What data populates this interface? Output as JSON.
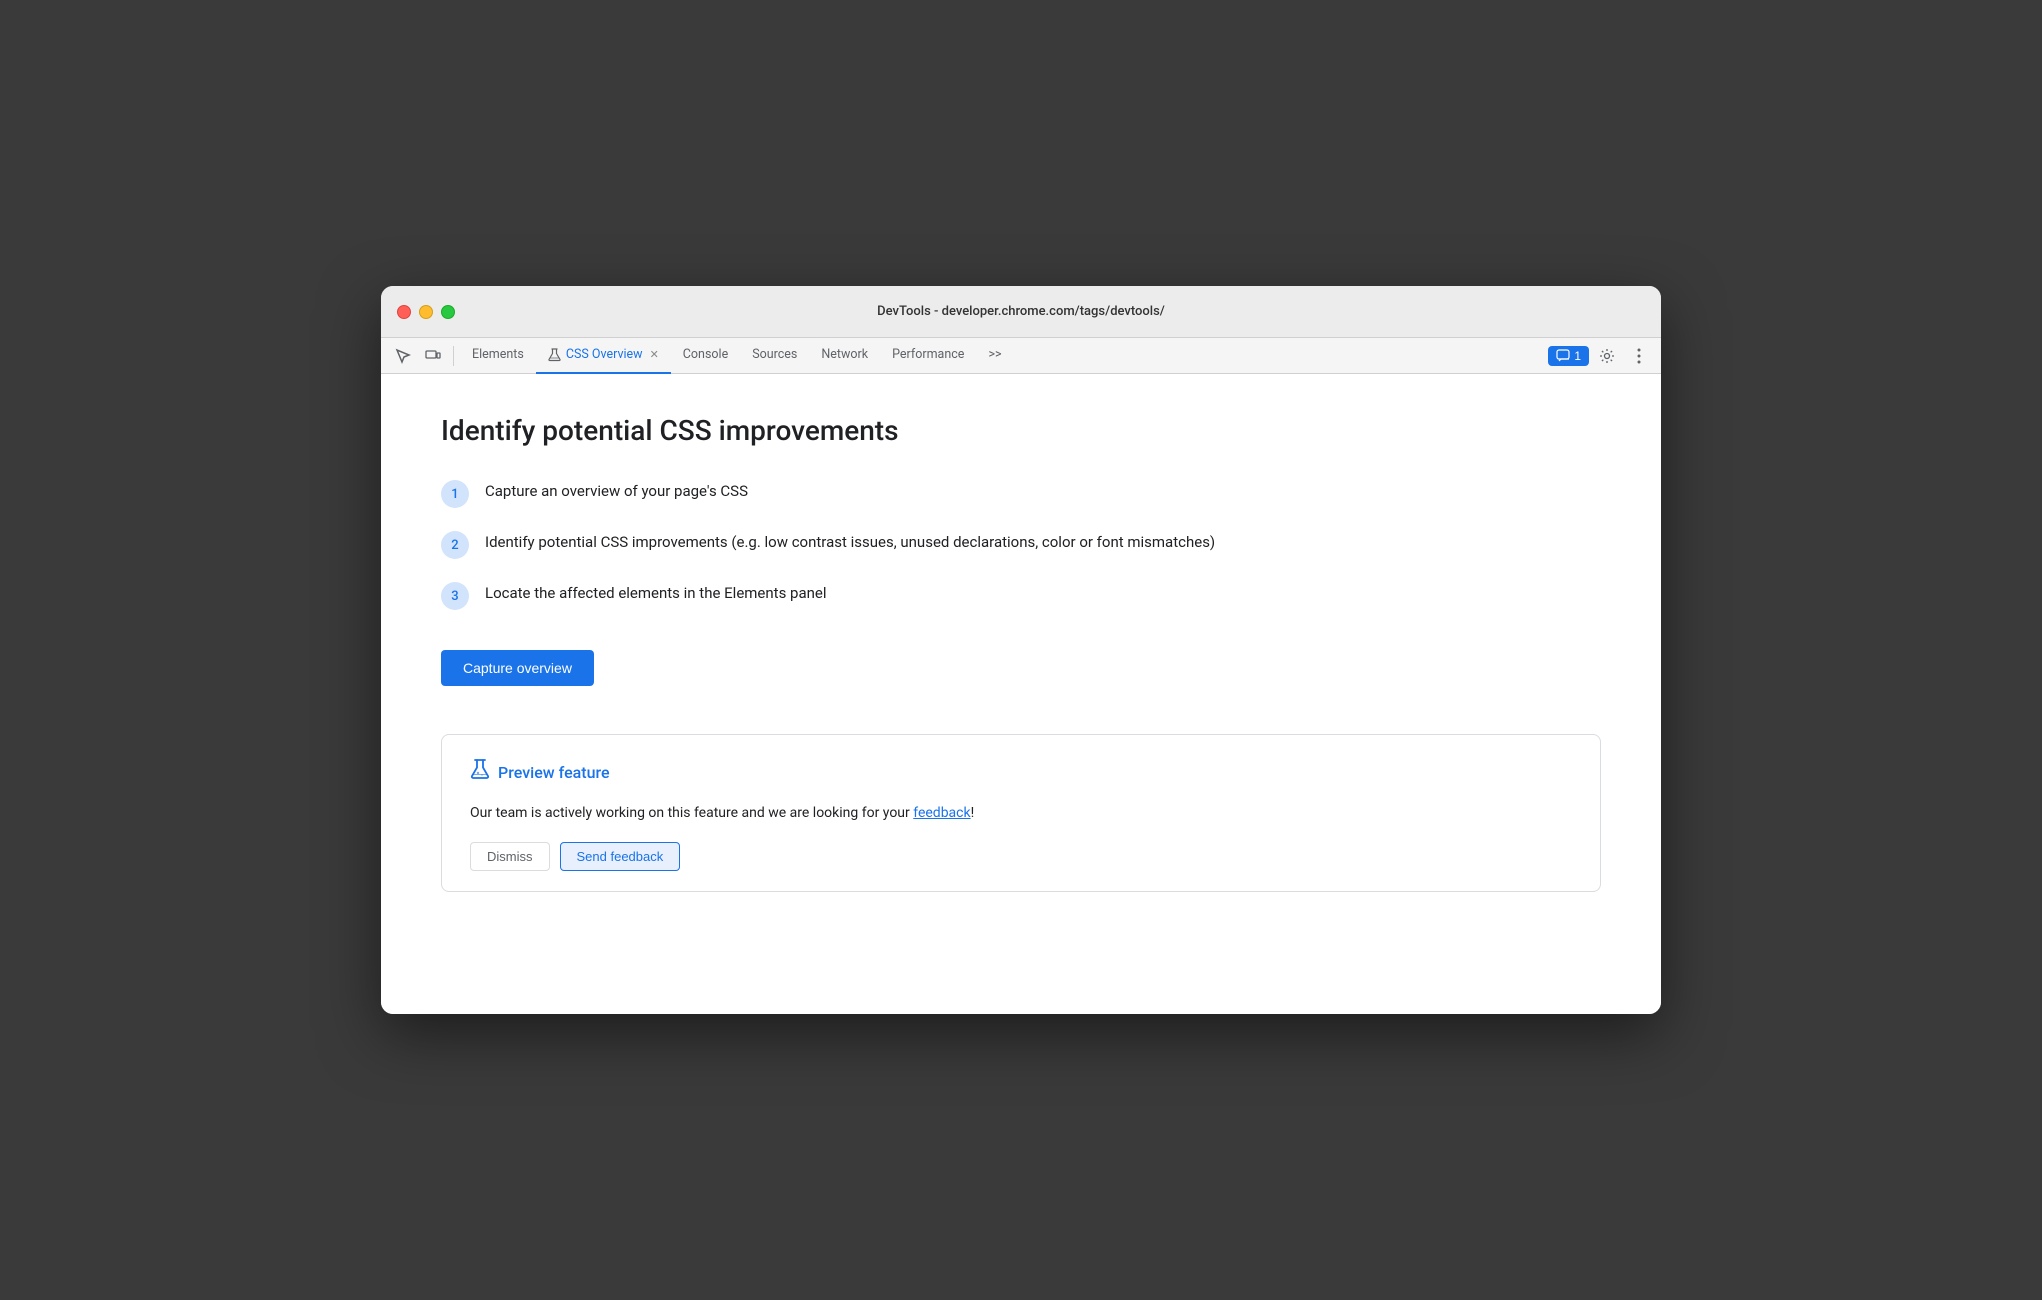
{
  "titlebar": {
    "url": "DevTools - developer.chrome.com/tags/devtools/"
  },
  "toolbar": {
    "tabs": [
      {
        "id": "elements",
        "label": "Elements",
        "active": false,
        "closable": false
      },
      {
        "id": "css-overview",
        "label": "CSS Overview",
        "active": true,
        "closable": true,
        "icon": "flask"
      },
      {
        "id": "console",
        "label": "Console",
        "active": false,
        "closable": false
      },
      {
        "id": "sources",
        "label": "Sources",
        "active": false,
        "closable": false
      },
      {
        "id": "network",
        "label": "Network",
        "active": false,
        "closable": false
      },
      {
        "id": "performance",
        "label": "Performance",
        "active": false,
        "closable": false
      }
    ],
    "more_tabs_label": ">>",
    "badge_count": "1",
    "badge_icon": "chat"
  },
  "content": {
    "page_title": "Identify potential CSS improvements",
    "steps": [
      {
        "number": "1",
        "text": "Capture an overview of your page's CSS"
      },
      {
        "number": "2",
        "text": "Identify potential CSS improvements (e.g. low contrast issues, unused declarations, color or font mismatches)"
      },
      {
        "number": "3",
        "text": "Locate the affected elements in the Elements panel"
      }
    ],
    "capture_button_label": "Capture overview",
    "preview_feature": {
      "title": "Preview feature",
      "body_start": "Our team is actively working on this feature and we are looking for your ",
      "link_text": "feedback",
      "body_end": "!"
    }
  },
  "colors": {
    "blue": "#1a73e8",
    "step_circle_bg": "#d2e3fc",
    "step_circle_text": "#1a73e8"
  }
}
